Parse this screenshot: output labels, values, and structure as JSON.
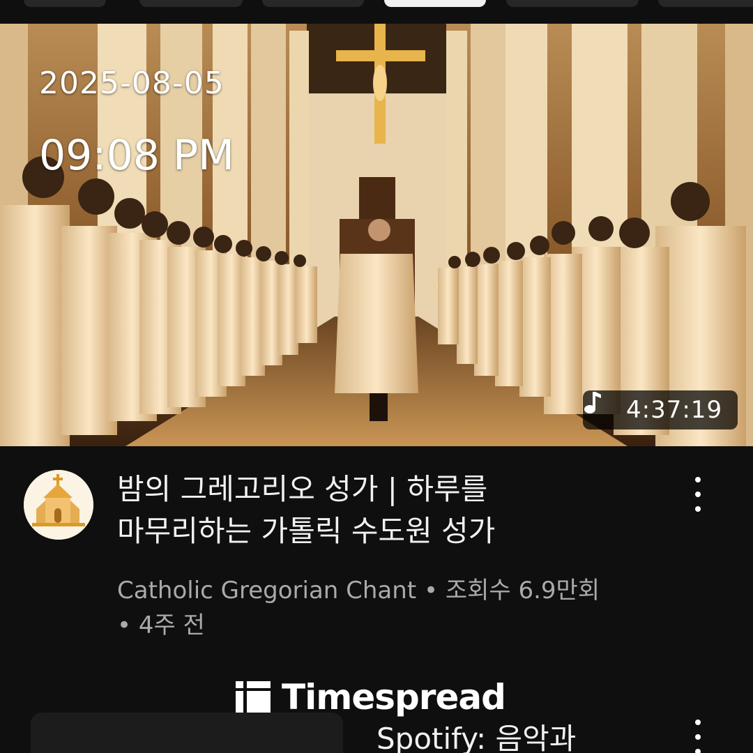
{
  "thumbnail": {
    "date": "2025-08-05",
    "time": "09:08 PM",
    "duration": "4:37:19",
    "duration_icon": "music-note-icon"
  },
  "video": {
    "title_line1": "밤의 그레고리오 성가 | 하루를",
    "title_line2": "마무리하는 가톨릭 수도원 성가",
    "meta_line1": "Catholic Gregorian Chant • 조회수 6.9만회",
    "meta_line2": "• 4주 전",
    "channel_avatar_icon": "church-icon",
    "menu_icon": "more-vert-icon"
  },
  "watermark": {
    "text": "Timespread",
    "icon": "timespread-logo-icon"
  },
  "next_video": {
    "title_partial": "Spotify: 음악과",
    "menu_icon": "more-vert-icon"
  },
  "colors": {
    "background": "#0f0f0f",
    "text_primary": "#f1f1f1",
    "text_secondary": "#aaaaaa",
    "duration_bg": "#000000b8"
  }
}
